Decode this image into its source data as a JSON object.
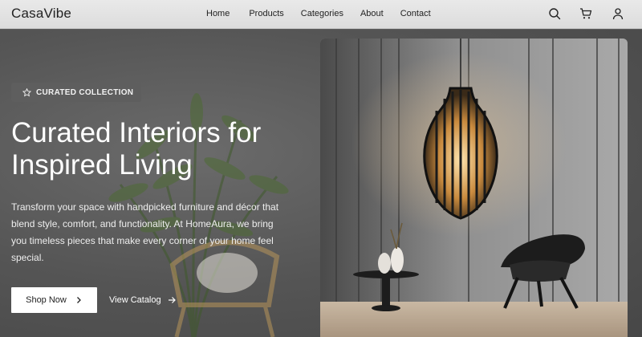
{
  "brand": {
    "name": "CasaVibe"
  },
  "nav": {
    "items": [
      "Home",
      "Products",
      "Categories",
      "About",
      "Contact"
    ]
  },
  "header_icons": [
    "search-icon",
    "cart-icon",
    "user-icon"
  ],
  "hero": {
    "badge": "CURATED COLLECTION",
    "headline_line1": "Curated Interiors for",
    "headline_line2": "Inspired Living",
    "description": "Transform your space with handpicked furniture and décor that blend style, comfort, and functionality. At HomeAura, we bring you timeless pieces that make every corner of your home feel special.",
    "primary_button": "Shop Now",
    "secondary_button": "View Catalog"
  },
  "colors": {
    "header_bg": "#e0e0e0",
    "hero_bg": "#555555",
    "primary_button_bg": "#ffffff",
    "badge_bg": "#5e5e5e"
  }
}
